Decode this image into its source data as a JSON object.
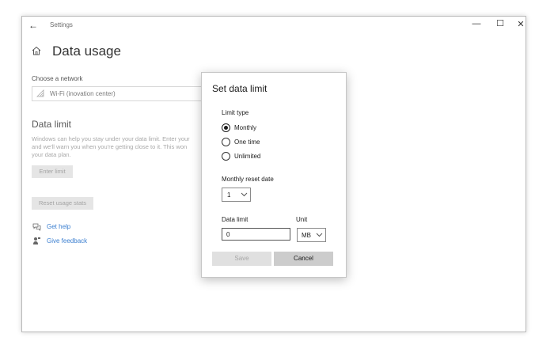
{
  "window": {
    "title": "Settings",
    "back_glyph": "←",
    "minimize_glyph": "—",
    "maximize_glyph": "☐",
    "close_glyph": "✕"
  },
  "page": {
    "title": "Data usage",
    "home_icon": "home-icon"
  },
  "network": {
    "label": "Choose a network",
    "value": "Wi-Fi (inovation center)",
    "icon": "wifi-icon"
  },
  "data_limit_section": {
    "title": "Data limit",
    "description_lines": [
      "Windows can help you stay under your data limit. Enter your",
      "and we'll warn you when you're getting close to it. This won",
      "your data plan."
    ],
    "enter_limit_label": "Enter limit",
    "reset_stats_label": "Reset usage stats"
  },
  "links": {
    "get_help": "Get help",
    "give_feedback": "Give feedback"
  },
  "dialog": {
    "title": "Set data limit",
    "limit_type_label": "Limit type",
    "limit_types": [
      "Monthly",
      "One time",
      "Unlimited"
    ],
    "selected_limit_type": "Monthly",
    "reset_date_label": "Monthly reset date",
    "reset_date_value": "1",
    "data_limit_label": "Data limit",
    "data_limit_value": "0",
    "unit_label": "Unit",
    "unit_value": "MB",
    "save_label": "Save",
    "cancel_label": "Cancel"
  },
  "colors": {
    "link": "#3b7fd0",
    "disabled_text": "#a8a8a8",
    "disabled_button": "#e5e5e5"
  }
}
